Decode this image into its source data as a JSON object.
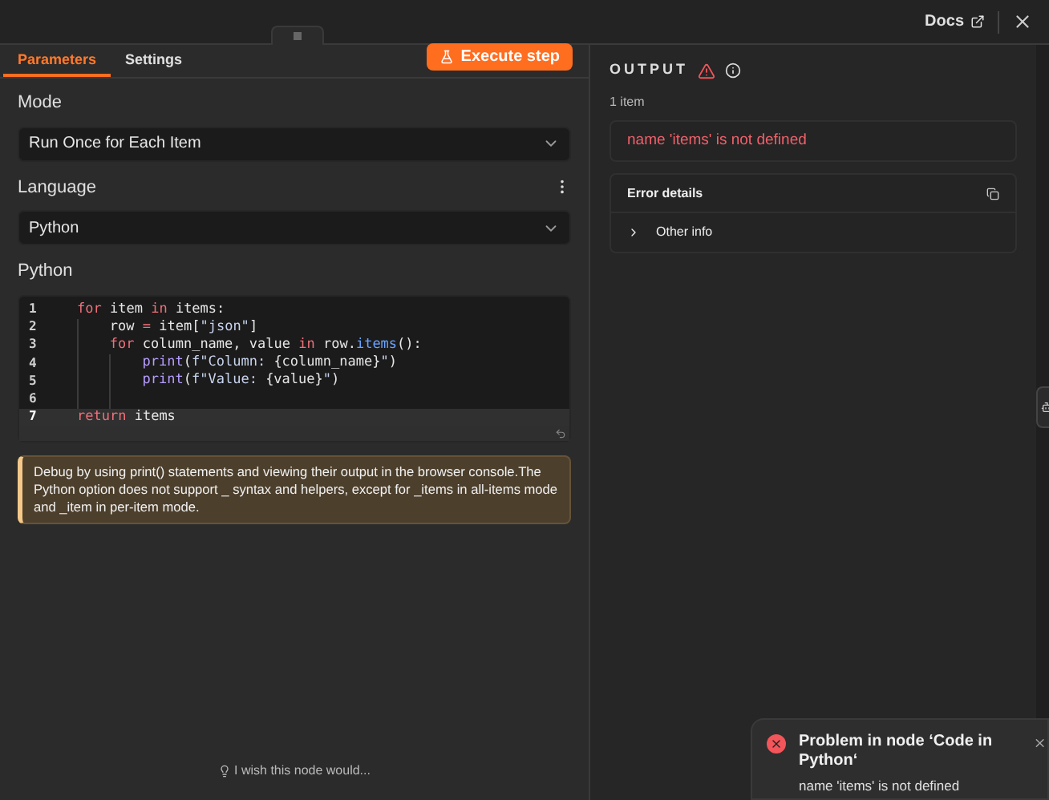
{
  "header": {
    "docs_link": "Docs"
  },
  "tabs": [
    {
      "label": "Parameters",
      "selected": true
    },
    {
      "label": "Settings",
      "selected": false
    }
  ],
  "execute_button": "Execute step",
  "mode": {
    "label": "Mode",
    "value": "Run Once for Each Item"
  },
  "language": {
    "label": "Language",
    "value": "Python"
  },
  "code": {
    "label": "Python",
    "lines": [
      {
        "number": "1",
        "selected": false,
        "tokens": [
          {
            "kind": "keyword",
            "text": "for"
          },
          {
            "kind": "plain",
            "text": " item "
          },
          {
            "kind": "keyword",
            "text": "in"
          },
          {
            "kind": "plain",
            "text": " items:"
          }
        ],
        "children": [
          {
            "number": "2",
            "selected": false,
            "tokens": [
              {
                "kind": "plain",
                "text": "row "
              },
              {
                "kind": "keyword",
                "text": "="
              },
              {
                "kind": "plain",
                "text": " item["
              },
              {
                "kind": "string",
                "text": "\"json\""
              },
              {
                "kind": "plain",
                "text": "]"
              }
            ]
          },
          {
            "number": "3",
            "selected": false,
            "tokens": [
              {
                "kind": "keyword",
                "text": "for"
              },
              {
                "kind": "plain",
                "text": " column_name, value "
              },
              {
                "kind": "keyword",
                "text": "in"
              },
              {
                "kind": "plain",
                "text": " row."
              },
              {
                "kind": "method",
                "text": "items"
              },
              {
                "kind": "plain",
                "text": "():"
              }
            ],
            "children": [
              {
                "number": "4",
                "selected": false,
                "tokens": [
                  {
                    "kind": "function",
                    "text": "print"
                  },
                  {
                    "kind": "plain",
                    "text": "("
                  },
                  {
                    "kind": "string",
                    "text": "f\"Column: "
                  },
                  {
                    "kind": "plain",
                    "text": "{column_name}"
                  },
                  {
                    "kind": "string",
                    "text": "\""
                  },
                  {
                    "kind": "plain",
                    "text": ")"
                  }
                ]
              },
              {
                "number": "5",
                "selected": false,
                "tokens": [
                  {
                    "kind": "function",
                    "text": "print"
                  },
                  {
                    "kind": "plain",
                    "text": "("
                  },
                  {
                    "kind": "string",
                    "text": "f\"Value: "
                  },
                  {
                    "kind": "plain",
                    "text": "{value}"
                  },
                  {
                    "kind": "string",
                    "text": "\""
                  },
                  {
                    "kind": "plain",
                    "text": ")"
                  }
                ]
              },
              {
                "number": "6",
                "selected": false
              }
            ]
          }
        ]
      },
      {
        "number": "7",
        "selected": true,
        "tokens": [
          {
            "kind": "keyword",
            "text": "return"
          },
          {
            "kind": "plain",
            "text": " items"
          }
        ]
      }
    ]
  },
  "notice": "Debug by using print() statements and viewing their output in the browser console.The Python option does not support _ syntax and helpers, except for _items in all-items mode and _item in per-item mode.",
  "feedback": "I wish this node would...",
  "output": {
    "title": "OUTPUT",
    "count": "1 item",
    "error": "name 'items' is not defined",
    "details_title": "Error details",
    "other_info": "Other info",
    "other_info_expanded": false
  },
  "toast": {
    "title": "Problem in node ‘Code in Python‘",
    "message": "name 'items' is not defined"
  }
}
